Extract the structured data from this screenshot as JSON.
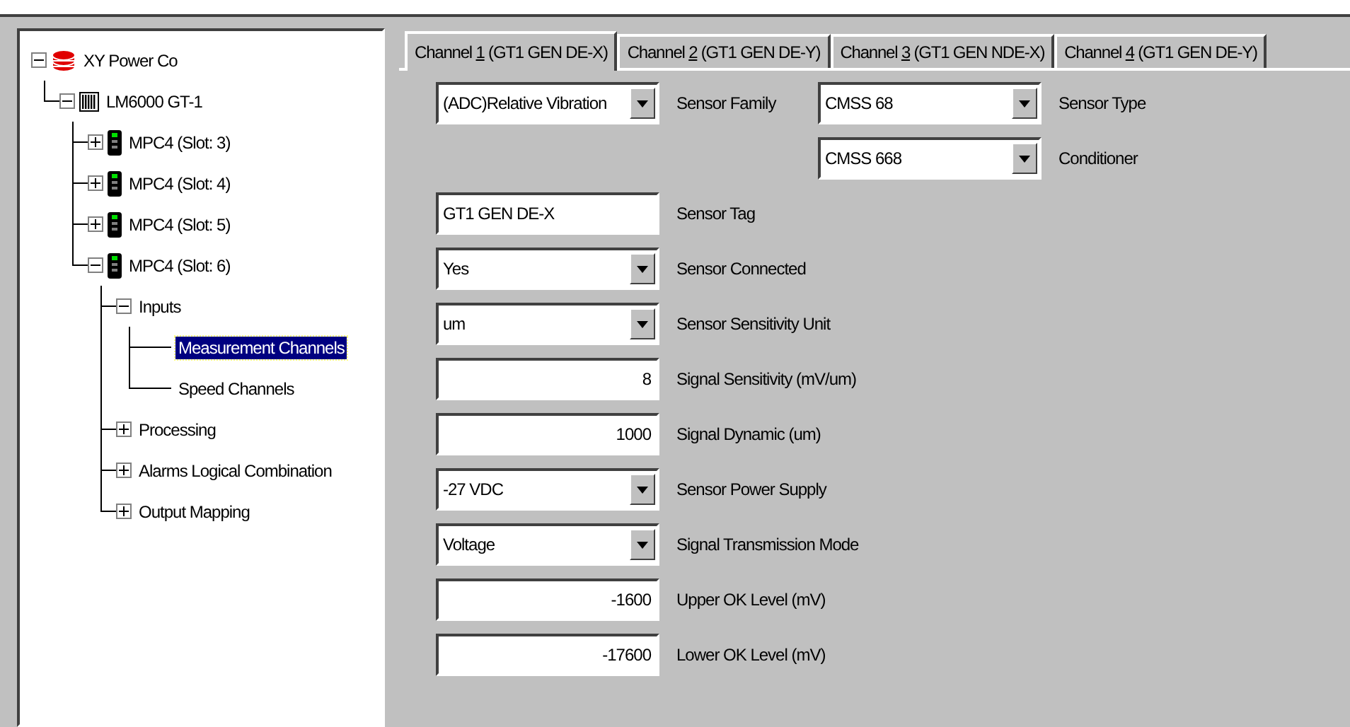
{
  "tree": {
    "items": [
      {
        "label": "XY Power Co",
        "kind": "database",
        "expanded": true,
        "selected": false,
        "children": [
          {
            "label": "LM6000 GT-1",
            "kind": "rack",
            "expanded": true,
            "selected": false,
            "children": [
              {
                "label": "MPC4 (Slot:  3)",
                "kind": "module",
                "expanded": false,
                "selected": false
              },
              {
                "label": "MPC4 (Slot:  4)",
                "kind": "module",
                "expanded": false,
                "selected": false
              },
              {
                "label": "MPC4 (Slot:  5)",
                "kind": "module",
                "expanded": false,
                "selected": false
              },
              {
                "label": "MPC4 (Slot:  6)",
                "kind": "module",
                "expanded": true,
                "selected": false,
                "children": [
                  {
                    "label": "Inputs",
                    "expanded": true,
                    "selected": false,
                    "children": [
                      {
                        "label": "Measurement Channels",
                        "selected": true
                      },
                      {
                        "label": "Speed Channels",
                        "selected": false
                      }
                    ]
                  },
                  {
                    "label": "Processing",
                    "expanded": false,
                    "selected": false
                  },
                  {
                    "label": "Alarms Logical Combination",
                    "expanded": false,
                    "selected": false
                  },
                  {
                    "label": "Output Mapping",
                    "expanded": false,
                    "selected": false
                  }
                ]
              }
            ]
          }
        ]
      }
    ]
  },
  "tabs": [
    {
      "prefix": "Channel ",
      "accel": "1",
      "suffix": " (GT1 GEN DE-X)",
      "selected": true
    },
    {
      "prefix": "Channel ",
      "accel": "2",
      "suffix": " (GT1 GEN DE-Y)",
      "selected": false
    },
    {
      "prefix": "Channel ",
      "accel": "3",
      "suffix": " (GT1 GEN NDE-X)",
      "selected": false
    },
    {
      "prefix": "Channel ",
      "accel": "4",
      "suffix": " (GT1 GEN DE-Y)",
      "selected": false
    }
  ],
  "sensor": {
    "left": [
      {
        "kind": "dropdown",
        "value": "(ADC)Relative Vibration",
        "label": "Sensor Family"
      }
    ],
    "right": [
      {
        "kind": "dropdown",
        "value": "CMSS 68",
        "label": "Sensor Type"
      },
      {
        "kind": "dropdown",
        "value": "CMSS 668",
        "label": "Conditioner"
      }
    ]
  },
  "fields": [
    {
      "kind": "text",
      "value": "GT1 GEN DE-X",
      "label": "Sensor Tag"
    },
    {
      "kind": "dropdown",
      "value": "Yes",
      "label": "Sensor Connected"
    },
    {
      "kind": "dropdown",
      "value": "um",
      "label": "Sensor Sensitivity Unit"
    },
    {
      "kind": "number",
      "value": "8",
      "label": "Signal Sensitivity (mV/um)"
    },
    {
      "kind": "number",
      "value": "1000",
      "label": "Signal Dynamic (um)"
    },
    {
      "kind": "dropdown",
      "value": "-27 VDC",
      "label": "Sensor Power Supply"
    },
    {
      "kind": "dropdown",
      "value": "Voltage",
      "label": "Signal Transmission Mode"
    },
    {
      "kind": "number",
      "value": "-1600",
      "label": "Upper OK Level (mV)"
    },
    {
      "kind": "number",
      "value": "-17600",
      "label": "Lower OK Level (mV)"
    }
  ]
}
